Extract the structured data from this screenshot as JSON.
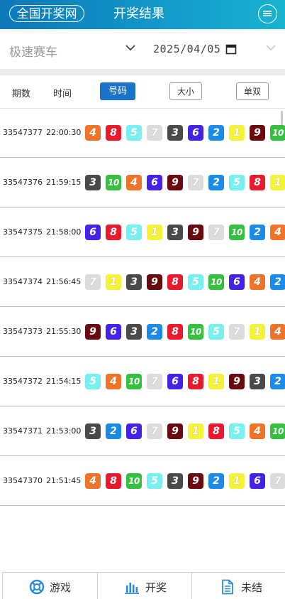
{
  "header": {
    "logo": "全国开奖网",
    "title": "开奖结果",
    "menu_icon": "menu-icon"
  },
  "filter": {
    "game": "极速赛车",
    "date": "2025/04/05"
  },
  "tabs": {
    "period": "期数",
    "time": "时间",
    "number": "号码",
    "size": "大小",
    "parity": "单双"
  },
  "ball_colors": {
    "1": "#f5f23a",
    "2": "#1a8be8",
    "3": "#4a4a4a",
    "4": "#f0732a",
    "5": "#78f0f0",
    "6": "#4422e8",
    "7": "#dcdcdc",
    "8": "#e81a2c",
    "9": "#6a0a0e",
    "10": "#36c040"
  },
  "rows": [
    {
      "id": "33547377",
      "time": "22:00:30",
      "nums": [
        4,
        8,
        5,
        7,
        3,
        6,
        2,
        1,
        9,
        10
      ]
    },
    {
      "id": "33547376",
      "time": "21:59:15",
      "nums": [
        3,
        10,
        4,
        6,
        9,
        7,
        2,
        5,
        8,
        1
      ]
    },
    {
      "id": "33547375",
      "time": "21:58:00",
      "nums": [
        6,
        8,
        5,
        1,
        3,
        9,
        7,
        10,
        2,
        4
      ]
    },
    {
      "id": "33547374",
      "time": "21:56:45",
      "nums": [
        7,
        1,
        3,
        9,
        8,
        5,
        10,
        6,
        4,
        2
      ]
    },
    {
      "id": "33547373",
      "time": "21:55:30",
      "nums": [
        9,
        6,
        3,
        2,
        8,
        10,
        5,
        7,
        1,
        4
      ]
    },
    {
      "id": "33547372",
      "time": "21:54:15",
      "nums": [
        5,
        4,
        10,
        7,
        6,
        8,
        1,
        9,
        3,
        2
      ]
    },
    {
      "id": "33547371",
      "time": "21:53:00",
      "nums": [
        3,
        2,
        6,
        7,
        9,
        1,
        8,
        5,
        4,
        10
      ]
    },
    {
      "id": "33547370",
      "time": "21:51:45",
      "nums": [
        4,
        8,
        10,
        5,
        3,
        9,
        2,
        1,
        6,
        7
      ]
    }
  ],
  "footer": {
    "games": "游戏",
    "draw": "开奖",
    "unsettled": "未结"
  }
}
